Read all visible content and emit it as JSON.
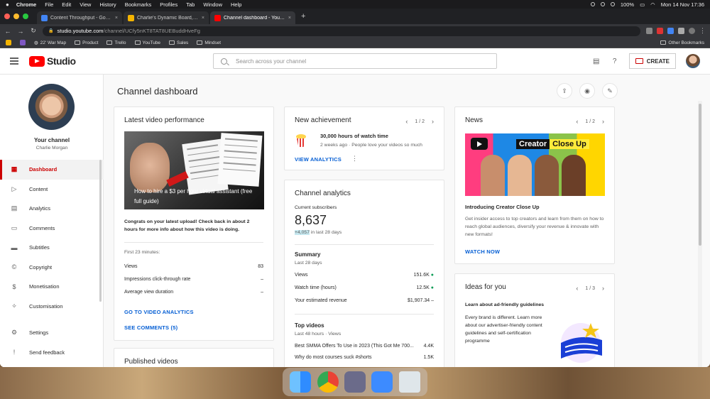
{
  "menubar": {
    "app": "Chrome",
    "items": [
      "File",
      "Edit",
      "View",
      "History",
      "Bookmarks",
      "Profiles",
      "Tab",
      "Window",
      "Help"
    ],
    "battery": "100%",
    "datetime": "Mon 14 Nov  17:36"
  },
  "tabs": [
    {
      "title": "Content Throughput - Google",
      "color": "#4285f4"
    },
    {
      "title": "Charlie's Dynamic Board, Onli",
      "color": "#f4b400"
    },
    {
      "title": "Channel dashboard - YouTube",
      "color": "#ff0000"
    }
  ],
  "address": {
    "host": "studio.youtube.com",
    "path": "/channel/UCfy5nKT8TAT8UEBuddHveFg"
  },
  "bookmarks": [
    {
      "label": "",
      "kind": "sq",
      "color": "#f4b400"
    },
    {
      "label": "",
      "kind": "sq",
      "color": "#7e57c2"
    },
    {
      "label": "22' War Map",
      "kind": "globe"
    },
    {
      "label": "Product",
      "kind": "folder"
    },
    {
      "label": "Trello",
      "kind": "folder"
    },
    {
      "label": "YouTube",
      "kind": "folder"
    },
    {
      "label": "Sales",
      "kind": "folder"
    },
    {
      "label": "Mindset",
      "kind": "folder"
    }
  ],
  "bookmarks_right": "Other Bookmarks",
  "studio": {
    "logo_text": "Studio",
    "search_placeholder": "Search across your channel",
    "create_label": "CREATE"
  },
  "sidebar": {
    "your_channel": "Your channel",
    "channel_name": "Charlie Morgan",
    "items": [
      {
        "label": "Dashboard",
        "icon": "grid-icon",
        "glyph": "▦"
      },
      {
        "label": "Content",
        "icon": "video-icon",
        "glyph": "▷"
      },
      {
        "label": "Analytics",
        "icon": "bar-chart-icon",
        "glyph": "▤"
      },
      {
        "label": "Comments",
        "icon": "comment-icon",
        "glyph": "▭"
      },
      {
        "label": "Subtitles",
        "icon": "subtitles-icon",
        "glyph": "▬"
      },
      {
        "label": "Copyright",
        "icon": "copyright-icon",
        "glyph": "©"
      },
      {
        "label": "Monetisation",
        "icon": "dollar-icon",
        "glyph": "$"
      },
      {
        "label": "Customisation",
        "icon": "magic-wand-icon",
        "glyph": "✧"
      }
    ],
    "bottom": [
      {
        "label": "Settings",
        "icon": "gear-icon",
        "glyph": "⚙"
      },
      {
        "label": "Send feedback",
        "icon": "feedback-icon",
        "glyph": "!"
      }
    ]
  },
  "page_title": "Channel dashboard",
  "latest": {
    "title": "Latest video performance",
    "thumb_caption": "How to hire a $3 per hour virtual assistant (free full guide)",
    "congrats": "Congrats on your latest upload! Check back in about 2 hours for more info about how this video is doing.",
    "first_minutes": "First 23 minutes:",
    "rows": [
      {
        "label": "Views",
        "value": "83"
      },
      {
        "label": "Impressions click-through rate",
        "value": "–"
      },
      {
        "label": "Average view duration",
        "value": "–"
      }
    ],
    "link_analytics": "GO TO VIDEO ANALYTICS",
    "link_comments": "SEE COMMENTS (5)"
  },
  "published": {
    "title": "Published videos"
  },
  "achievement": {
    "title": "New achievement",
    "pager": "1 / 2",
    "headline": "30,000 hours of watch time",
    "sub": "2 weeks ago · People love your videos so much",
    "link": "VIEW ANALYTICS"
  },
  "analytics": {
    "title": "Channel analytics",
    "subs_label": "Current subscribers",
    "subs_value": "8,637",
    "subs_change": "+4,057",
    "subs_change_suffix": " in last 28 days",
    "summary_title": "Summary",
    "summary_period": "Last 28 days",
    "summary_rows": [
      {
        "label": "Views",
        "value": "151.6K",
        "trend": "up"
      },
      {
        "label": "Watch time (hours)",
        "value": "12.5K",
        "trend": "up"
      },
      {
        "label": "Your estimated revenue",
        "value": "$1,907.34",
        "trend": "flat"
      }
    ],
    "top_title": "Top videos",
    "top_period": "Last 48 hours · Views",
    "top_rows": [
      {
        "label": "Best SMMA Offers To Use in 2023 (This Got Me 700...",
        "value": "4.4K"
      },
      {
        "label": "Why do most courses suck #shorts",
        "value": "1.5K"
      }
    ]
  },
  "news": {
    "title": "News",
    "pager": "1 / 2",
    "banner_1": "Creator",
    "banner_2": "Close Up",
    "headline": "Introducing Creator Close Up",
    "body": "Get insider access to top creators and learn from them on how to reach global audiences, diversify your revenue & innovate with new formats!",
    "link": "WATCH NOW"
  },
  "ideas": {
    "title": "Ideas for you",
    "pager": "1 / 3",
    "headline": "Learn about ad-friendly guidelines",
    "body": "Every brand is different. Learn more about our advertiser-friendly content guidelines and self-certification programme"
  },
  "colors": {
    "accent_red": "#cc0000",
    "link_blue": "#065fd4",
    "trend_green": "#0f9d58"
  }
}
